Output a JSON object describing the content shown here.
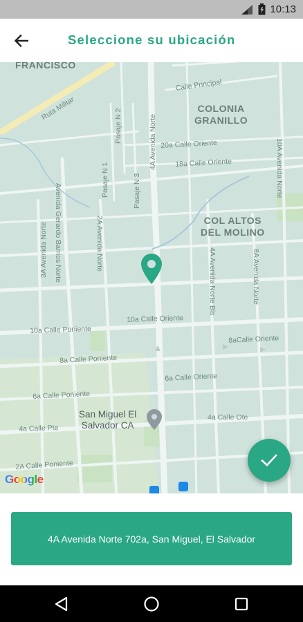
{
  "status_bar": {
    "time": "10:13",
    "icons": [
      "signal-icon",
      "battery-icon"
    ]
  },
  "app_bar": {
    "back_icon": "arrow-left-icon",
    "title": "Seleccione su ubicación"
  },
  "map": {
    "labels": {
      "francisco": "FRANCISCO",
      "ruta_militar": "Ruta Militar",
      "calle_principal": "Calle Principal",
      "pasaje_n2": "Pasaje N 2",
      "pasaje_n1": "Pasaje N 1",
      "pasaje_n3": "Pasaje N 3",
      "av_4a_norte_top": "4A Avenida Norte",
      "av_10a_norte": "10A Avenida Norte",
      "colonia_granillo": "COLONIA\nGRANILLO",
      "calle_20a": "20a Calle Oriente",
      "calle_18a": "18a Calle Oriente",
      "col_altos": "COL ALTOS\nDEL MOLINO",
      "av_3a_norte": "3A Avenida Norte",
      "av_gerardo": "Avenida Gerardo Barrios Norte",
      "av_2a_norte": "2A Avenida Norte",
      "av_4a_norte_bis": "4A Avenida Norte Bis",
      "av_8a_norte": "8A Avenida Norte",
      "calle_10a_ote": "10a Calle Oriente",
      "calle_10a_pte": "10a Calle Poniente",
      "calle_8a_ote": "8aCalle Oriente",
      "calle_8a_pte": "8a Calle Poniente",
      "calle_6a_ote": "6a Calle Oriente",
      "calle_6a_pte": "6a Calle Poniente",
      "calle_4a_pte": "4a Calle Pte",
      "calle_4a_ote": "4a Calle Ote",
      "san_miguel": "San Miguel El\nSalvador CA",
      "calle_2a_pte": "2A Calle Poniente",
      "google": "Google"
    },
    "pin_icon": "location-pin-icon",
    "poi_icon": "map-marker-icon",
    "confirm_icon": "check-icon"
  },
  "bottom": {
    "address": "4A Avenida Norte 702a, San Miguel, El Salvador"
  },
  "nav_bar": {
    "back": "nav-back-icon",
    "home": "nav-home-icon",
    "recents": "nav-recents-icon"
  },
  "colors": {
    "accent": "#2aa784",
    "map_bg": "#cfe2dc",
    "road": "#eef5f3"
  }
}
